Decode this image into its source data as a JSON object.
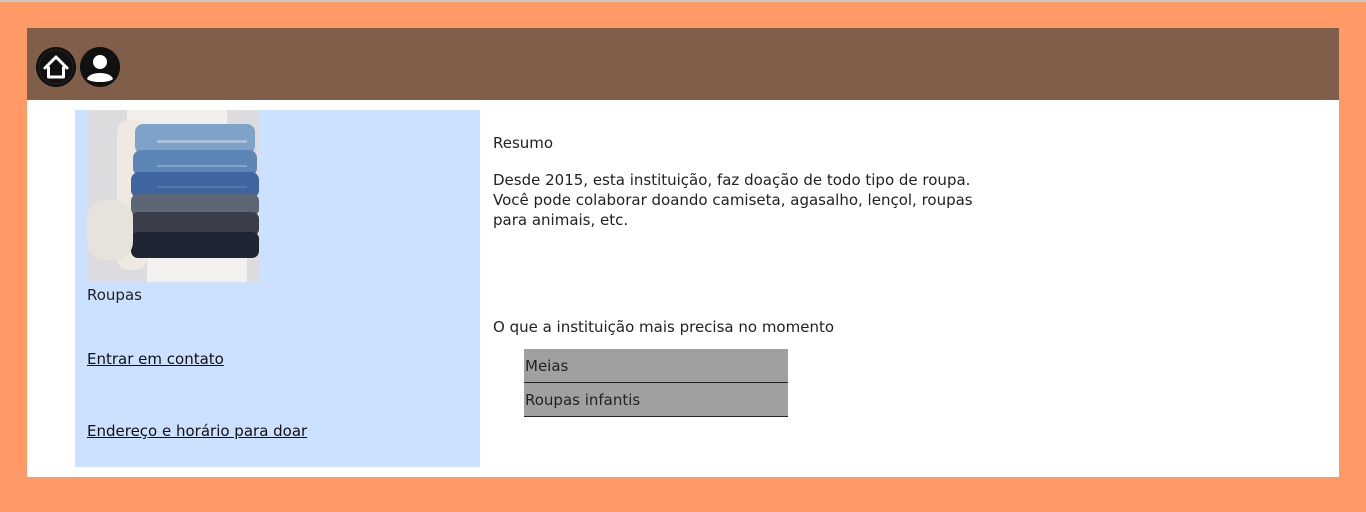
{
  "header": {
    "home_icon": "home-icon",
    "user_icon": "user-icon"
  },
  "sidebar": {
    "image_alt": "pilha de roupas jeans",
    "category": "Roupas",
    "contact_link": "Entrar em contato",
    "address_link": "Endereço e horário para doar"
  },
  "summary": {
    "title": "Resumo",
    "text": "Desde 2015, esta instituição, faz doação de todo tipo de roupa. Você pode colaborar doando camiseta, agasalho, lençol, roupas para animais, etc."
  },
  "needs": {
    "title": "O que a instituição mais precisa no momento",
    "items": [
      "Meias",
      "Roupas infantis"
    ]
  },
  "colors": {
    "page_background": "#FF9966",
    "header_background": "#805E4A",
    "sidebar_background": "#CCE0FF",
    "list_item_background": "#A0A0A0"
  }
}
